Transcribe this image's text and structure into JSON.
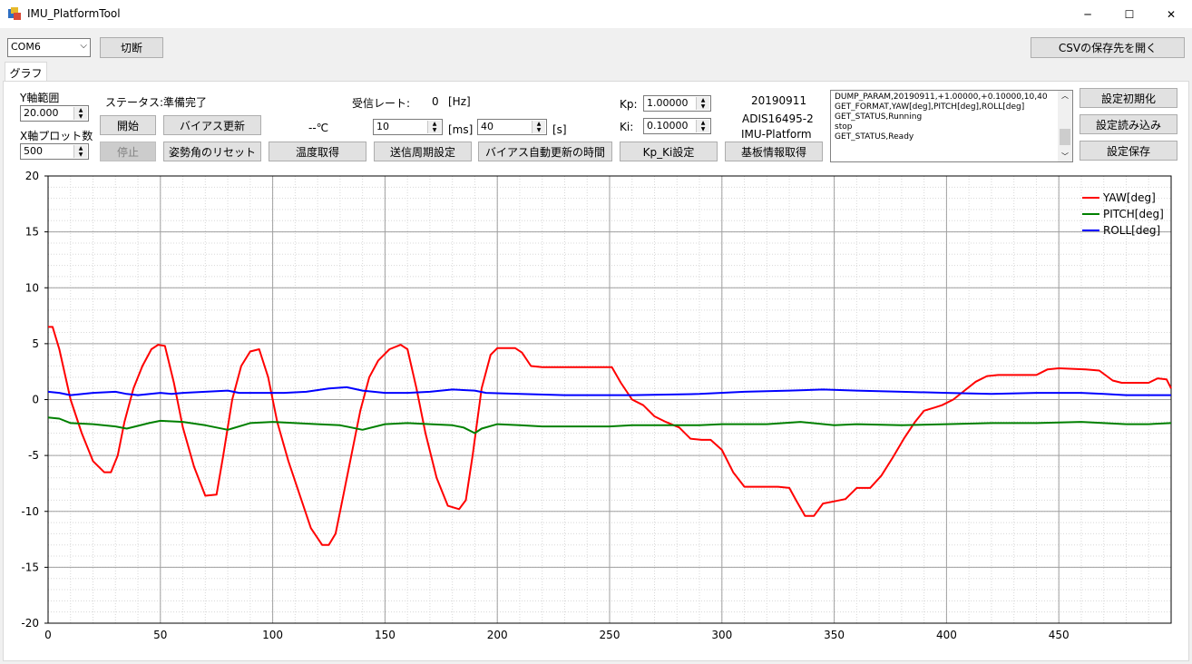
{
  "window": {
    "title": "IMU_PlatformTool",
    "minimize_glyph": "─",
    "maximize_glyph": "☐",
    "close_glyph": "✕"
  },
  "toolbar": {
    "port": "COM6",
    "disconnect_label": "切断",
    "csv_folder_label": "CSVの保存先を開く"
  },
  "tab": {
    "label": "グラフ"
  },
  "controls": {
    "y_range_label": "Y軸範囲",
    "y_range_value": "20.000",
    "x_points_label": "X軸プロット数",
    "x_points_value": "500",
    "status_label": "ステータス:",
    "status_value": "準備完了",
    "start_label": "開始",
    "stop_label": "停止",
    "bias_update_label": "バイアス更新",
    "reset_attitude_label": "姿勢角のリセット",
    "temp_value": "--℃",
    "get_temp_label": "温度取得",
    "rate_label": "受信レート:",
    "rate_value": "0",
    "rate_unit": "[Hz]",
    "period_value": "10",
    "period_unit": "[ms]",
    "period_button": "送信周期設定",
    "bias_time_value": "40",
    "bias_time_unit": "[s]",
    "bias_time_button": "バイアス自動更新の時間",
    "kp_label": "Kp:",
    "kp_value": "1.00000",
    "ki_label": "Ki:",
    "ki_value": "0.10000",
    "kpki_button": "Kp_Ki設定",
    "board_date": "20190911",
    "board_model": "ADIS16495-2",
    "board_name": "IMU-Platform",
    "board_button": "基板情報取得",
    "init_settings": "設定初期化",
    "load_settings": "設定読み込み",
    "save_settings": "設定保存"
  },
  "log": [
    "DUMP_PARAM,20190911,+1.00000,+0.10000,10,40",
    "GET_FORMAT,YAW[deg],PITCH[deg],ROLL[deg]",
    "GET_STATUS,Running",
    "stop",
    "GET_STATUS,Ready"
  ],
  "chart_data": {
    "type": "line",
    "xlim": [
      0,
      500
    ],
    "ylim": [
      -20,
      20
    ],
    "x_ticks": [
      "0",
      "50",
      "100",
      "150",
      "200",
      "250",
      "300",
      "350",
      "400",
      "450"
    ],
    "y_ticks": [
      "20",
      "15",
      "10",
      "5",
      "0",
      "-5",
      "-10",
      "-15",
      "-20"
    ],
    "grid": true,
    "legend": "top-right",
    "series": [
      {
        "name": "YAW[deg]",
        "color": "#ff0000",
        "points": [
          [
            0,
            6.5
          ],
          [
            2,
            6.5
          ],
          [
            5,
            4.5
          ],
          [
            10,
            0
          ],
          [
            15,
            -3
          ],
          [
            20,
            -5.5
          ],
          [
            25,
            -6.5
          ],
          [
            28,
            -6.5
          ],
          [
            31,
            -5
          ],
          [
            34,
            -2
          ],
          [
            38,
            1
          ],
          [
            42,
            3
          ],
          [
            46,
            4.5
          ],
          [
            49,
            4.9
          ],
          [
            52,
            4.8
          ],
          [
            56,
            1.5
          ],
          [
            60,
            -2.5
          ],
          [
            65,
            -6
          ],
          [
            70,
            -8.6
          ],
          [
            75,
            -8.5
          ],
          [
            78,
            -5
          ],
          [
            82,
            0
          ],
          [
            86,
            3
          ],
          [
            90,
            4.3
          ],
          [
            94,
            4.5
          ],
          [
            98,
            2
          ],
          [
            102,
            -2
          ],
          [
            107,
            -5.5
          ],
          [
            112,
            -8.5
          ],
          [
            117,
            -11.5
          ],
          [
            122,
            -13
          ],
          [
            125,
            -13
          ],
          [
            128,
            -12
          ],
          [
            131,
            -9
          ],
          [
            135,
            -5
          ],
          [
            139,
            -1
          ],
          [
            143,
            2
          ],
          [
            147,
            3.5
          ],
          [
            152,
            4.5
          ],
          [
            157,
            4.9
          ],
          [
            160,
            4.5
          ],
          [
            164,
            1
          ],
          [
            168,
            -3
          ],
          [
            173,
            -7
          ],
          [
            178,
            -9.5
          ],
          [
            183,
            -9.8
          ],
          [
            186,
            -9
          ],
          [
            189,
            -5
          ],
          [
            193,
            1
          ],
          [
            197,
            4
          ],
          [
            200,
            4.6
          ],
          [
            208,
            4.6
          ],
          [
            211,
            4.2
          ],
          [
            215,
            3
          ],
          [
            220,
            2.9
          ],
          [
            240,
            2.9
          ],
          [
            251,
            2.9
          ],
          [
            255,
            1.5
          ],
          [
            260,
            0
          ],
          [
            265,
            -0.5
          ],
          [
            270,
            -1.5
          ],
          [
            275,
            -2
          ],
          [
            281,
            -2.5
          ],
          [
            286,
            -3.5
          ],
          [
            291,
            -3.6
          ],
          [
            295,
            -3.6
          ],
          [
            300,
            -4.5
          ],
          [
            305,
            -6.5
          ],
          [
            310,
            -7.8
          ],
          [
            315,
            -7.8
          ],
          [
            325,
            -7.8
          ],
          [
            330,
            -7.9
          ],
          [
            333,
            -9
          ],
          [
            337,
            -10.4
          ],
          [
            341,
            -10.4
          ],
          [
            345,
            -9.3
          ],
          [
            350,
            -9.1
          ],
          [
            355,
            -8.9
          ],
          [
            360,
            -7.9
          ],
          [
            366,
            -7.9
          ],
          [
            371,
            -6.8
          ],
          [
            376,
            -5.2
          ],
          [
            381,
            -3.5
          ],
          [
            386,
            -2
          ],
          [
            390,
            -1
          ],
          [
            395,
            -0.7
          ],
          [
            398,
            -0.5
          ],
          [
            403,
            0
          ],
          [
            408,
            0.8
          ],
          [
            413,
            1.6
          ],
          [
            418,
            2.1
          ],
          [
            423,
            2.2
          ],
          [
            440,
            2.2
          ],
          [
            445,
            2.7
          ],
          [
            450,
            2.8
          ],
          [
            462,
            2.7
          ],
          [
            468,
            2.6
          ],
          [
            474,
            1.7
          ],
          [
            478,
            1.5
          ],
          [
            484,
            1.5
          ],
          [
            490,
            1.5
          ],
          [
            494,
            1.9
          ],
          [
            498,
            1.8
          ],
          [
            500,
            1
          ]
        ]
      },
      {
        "name": "PITCH[deg]",
        "color": "#008000",
        "points": [
          [
            0,
            -1.6
          ],
          [
            5,
            -1.7
          ],
          [
            10,
            -2.1
          ],
          [
            20,
            -2.2
          ],
          [
            30,
            -2.4
          ],
          [
            35,
            -2.6
          ],
          [
            45,
            -2.1
          ],
          [
            50,
            -1.9
          ],
          [
            60,
            -2
          ],
          [
            70,
            -2.3
          ],
          [
            80,
            -2.7
          ],
          [
            90,
            -2.1
          ],
          [
            100,
            -2
          ],
          [
            110,
            -2.1
          ],
          [
            120,
            -2.2
          ],
          [
            130,
            -2.3
          ],
          [
            140,
            -2.7
          ],
          [
            150,
            -2.2
          ],
          [
            160,
            -2.1
          ],
          [
            170,
            -2.2
          ],
          [
            180,
            -2.3
          ],
          [
            185,
            -2.5
          ],
          [
            190,
            -3
          ],
          [
            193,
            -2.6
          ],
          [
            200,
            -2.2
          ],
          [
            210,
            -2.3
          ],
          [
            220,
            -2.4
          ],
          [
            250,
            -2.4
          ],
          [
            260,
            -2.3
          ],
          [
            280,
            -2.3
          ],
          [
            290,
            -2.3
          ],
          [
            300,
            -2.2
          ],
          [
            320,
            -2.2
          ],
          [
            335,
            -2
          ],
          [
            350,
            -2.3
          ],
          [
            360,
            -2.2
          ],
          [
            380,
            -2.3
          ],
          [
            400,
            -2.2
          ],
          [
            420,
            -2.1
          ],
          [
            440,
            -2.1
          ],
          [
            460,
            -2
          ],
          [
            470,
            -2.1
          ],
          [
            480,
            -2.2
          ],
          [
            490,
            -2.2
          ],
          [
            500,
            -2.1
          ]
        ]
      },
      {
        "name": "ROLL[deg]",
        "color": "#0000ff",
        "points": [
          [
            0,
            0.7
          ],
          [
            5,
            0.6
          ],
          [
            10,
            0.4
          ],
          [
            20,
            0.6
          ],
          [
            30,
            0.7
          ],
          [
            35,
            0.5
          ],
          [
            40,
            0.4
          ],
          [
            50,
            0.6
          ],
          [
            55,
            0.5
          ],
          [
            60,
            0.6
          ],
          [
            70,
            0.7
          ],
          [
            80,
            0.8
          ],
          [
            85,
            0.6
          ],
          [
            95,
            0.6
          ],
          [
            105,
            0.6
          ],
          [
            115,
            0.7
          ],
          [
            125,
            1
          ],
          [
            133,
            1.1
          ],
          [
            140,
            0.8
          ],
          [
            150,
            0.6
          ],
          [
            160,
            0.6
          ],
          [
            170,
            0.7
          ],
          [
            180,
            0.9
          ],
          [
            190,
            0.8
          ],
          [
            195,
            0.6
          ],
          [
            210,
            0.5
          ],
          [
            230,
            0.4
          ],
          [
            260,
            0.4
          ],
          [
            290,
            0.5
          ],
          [
            310,
            0.7
          ],
          [
            330,
            0.8
          ],
          [
            345,
            0.9
          ],
          [
            360,
            0.8
          ],
          [
            380,
            0.7
          ],
          [
            400,
            0.6
          ],
          [
            420,
            0.5
          ],
          [
            440,
            0.6
          ],
          [
            460,
            0.6
          ],
          [
            470,
            0.5
          ],
          [
            480,
            0.4
          ],
          [
            500,
            0.4
          ]
        ]
      }
    ]
  }
}
